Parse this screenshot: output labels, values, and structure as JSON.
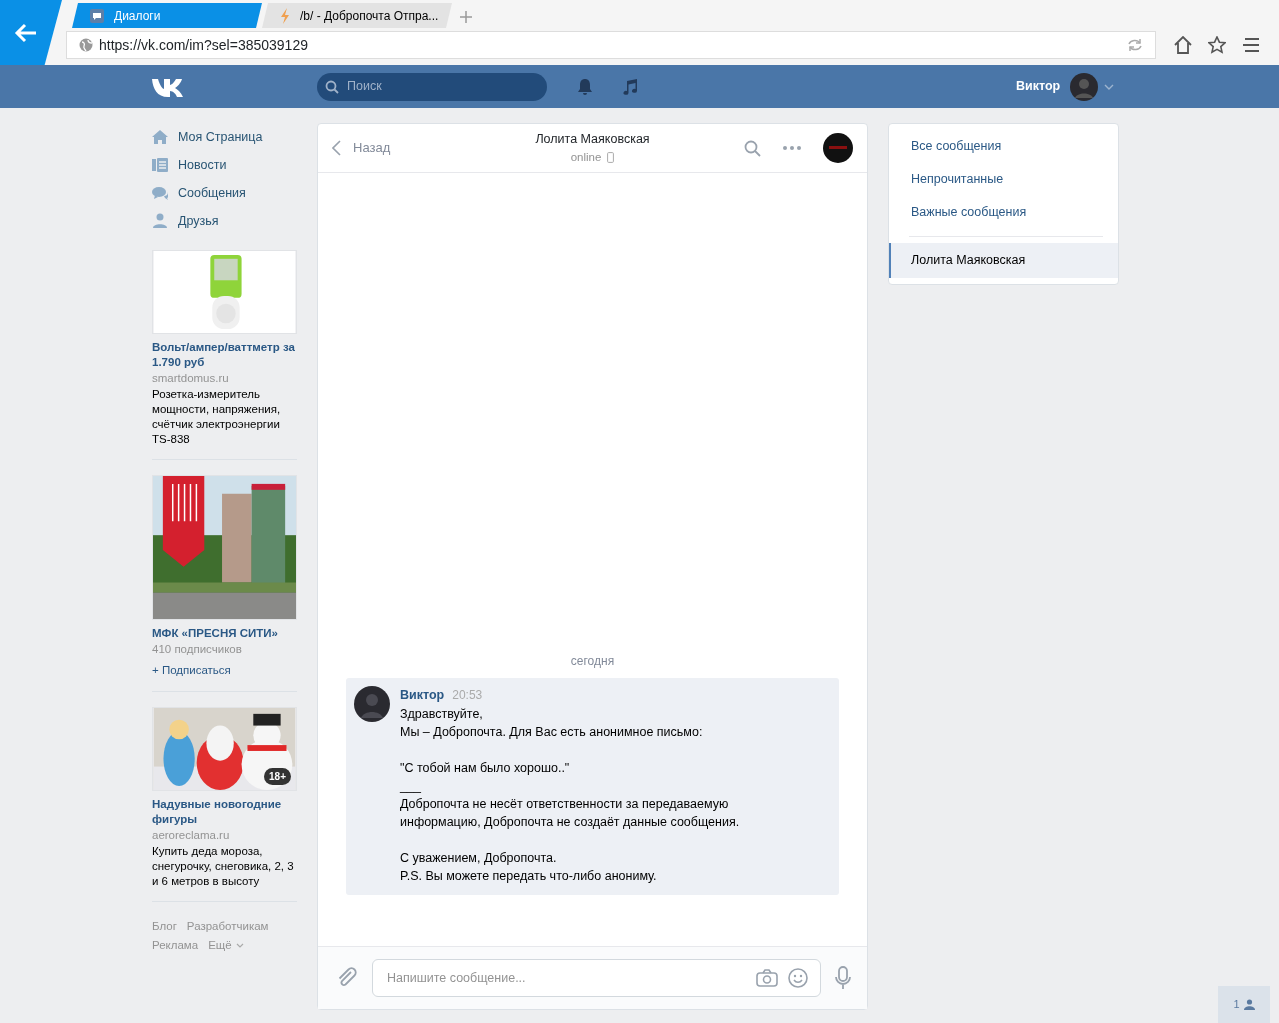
{
  "browser": {
    "tabs": [
      {
        "label": "Диалоги",
        "selected": true
      },
      {
        "label": "/b/ - Добропочта Отпра...",
        "selected": false
      }
    ],
    "address": "https://vk.com/im?sel=385039129"
  },
  "header": {
    "search": {
      "placeholder": "Поиск"
    },
    "user_name": "Виктор"
  },
  "sidebar": {
    "items": [
      {
        "label": "Моя Страница"
      },
      {
        "label": "Новости"
      },
      {
        "label": "Сообщения"
      },
      {
        "label": "Друзья"
      }
    ]
  },
  "ads": [
    {
      "kind": "product",
      "title": "Вольт/ампер/ваттметр за 1.790 руб",
      "domain": "smartdomus.ru",
      "description": "Розетка-измеритель мощности, напряжения, счётчик электроэнергии TS-838"
    },
    {
      "kind": "community",
      "title": "МФК «ПРЕСНЯ СИТИ»",
      "subscribers": "410 подписчиков",
      "action": "+ Подписаться"
    },
    {
      "kind": "product",
      "age_badge": "18+",
      "title": "Надувные новогодние фигуры",
      "domain": "aeroreclama.ru",
      "description": "Купить деда мороза, снегурочку, снеговика, 2, 3 и 6 метров в высоту"
    }
  ],
  "footer_links": [
    "Блог",
    "Разработчикам",
    "Реклама",
    "Ещё"
  ],
  "chat": {
    "back": "Назад",
    "title": "Лолита Маяковская",
    "status": "online",
    "date": "сегодня",
    "messages": [
      {
        "author": "Виктор",
        "time": "20:53",
        "paragraphs": [
          [
            "Здравствуйте,",
            "Мы – Добропочта. Для Вас есть анонимное письмо:"
          ],
          [
            "\"С тобой нам было хорошо..\"",
            "___",
            "Добропочта не несёт ответственности за передаваемую",
            "информацию, Добропочта не создаёт данные сообщения."
          ],
          [
            "С уважением, Добропочта.",
            "P.S. Вы можете передать что-либо анониму."
          ]
        ]
      }
    ],
    "input": {
      "placeholder": "Напишите сообщение..."
    }
  },
  "right_menu": {
    "filters": [
      {
        "label": "Все сообщения",
        "selected": false
      },
      {
        "label": "Непрочитанные",
        "selected": false
      },
      {
        "label": "Важные сообщения",
        "selected": false
      }
    ],
    "dialogs": [
      {
        "label": "Лолита Маяковская",
        "selected": true
      }
    ]
  },
  "online_friends": "1"
}
